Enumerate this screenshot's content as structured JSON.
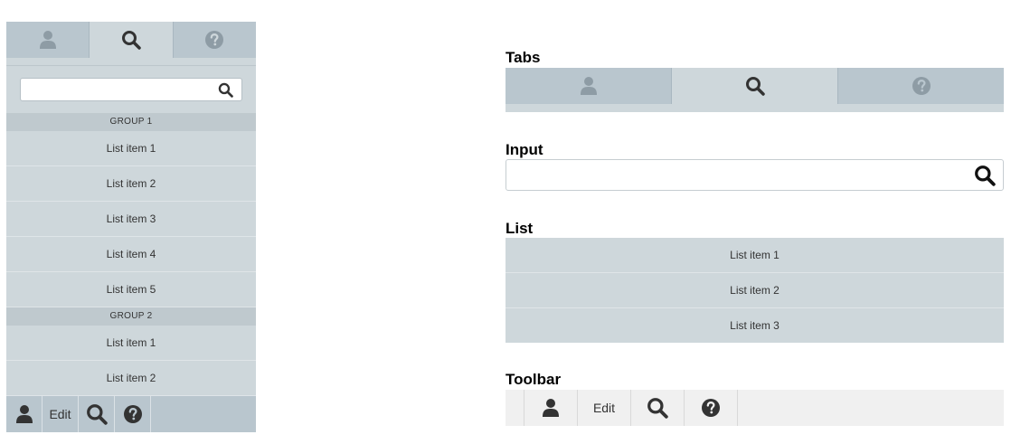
{
  "panel": {
    "tabs": [
      {
        "icon": "user-icon",
        "active": false
      },
      {
        "icon": "search-icon",
        "active": true
      },
      {
        "icon": "help-icon",
        "active": false
      }
    ],
    "search": {
      "value": "",
      "placeholder": ""
    },
    "groups": [
      {
        "label": "GROUP 1",
        "items": [
          "List item 1",
          "List item 2",
          "List item 3",
          "List item 4",
          "List item 5"
        ]
      },
      {
        "label": "GROUP 2",
        "items": [
          "List item 1",
          "List item 2"
        ]
      }
    ],
    "toolbar": {
      "edit_label": "Edit",
      "icons": [
        "user-icon",
        "search-icon",
        "help-icon"
      ]
    }
  },
  "demo": {
    "tabs_title": "Tabs",
    "input_title": "Input",
    "input": {
      "value": "",
      "placeholder": ""
    },
    "list_title": "List",
    "list_items": [
      "List item 1",
      "List item 2",
      "List item 3"
    ],
    "toolbar_title": "Toolbar",
    "toolbar": {
      "edit_label": "Edit"
    }
  },
  "colors": {
    "panel_bg": "#ced7db",
    "tab_bg": "#b9c6ce",
    "toolbar_bg": "#f0f0f0",
    "icon_dark": "#333333",
    "icon_muted": "#8e9ca5"
  }
}
